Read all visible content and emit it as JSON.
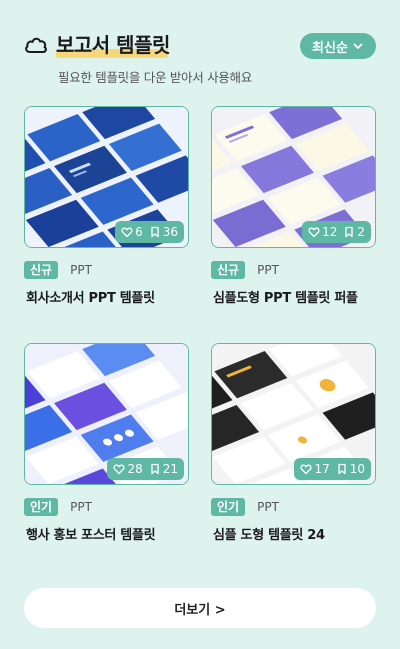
{
  "header": {
    "title": "보고서 템플릿",
    "subtitle": "필요한 템플릿을 다운 받아서 사용해요",
    "sort_label": "최신순",
    "title_icon": "cloud-icon",
    "highlight_color": "#f6d77a"
  },
  "accent_color": "#5fb8a4",
  "cards": [
    {
      "badge": "신규",
      "format": "PPT",
      "name": "회사소개서 PPT 템플릿",
      "likes": "6",
      "bookmarks": "36"
    },
    {
      "badge": "신규",
      "format": "PPT",
      "name": "심플도형 PPT 템플릿 퍼플",
      "likes": "12",
      "bookmarks": "2"
    },
    {
      "badge": "인기",
      "format": "PPT",
      "name": "행사 홍보 포스터 템플릿",
      "likes": "28",
      "bookmarks": "21"
    },
    {
      "badge": "인기",
      "format": "PPT",
      "name": "심플 도형 템플릿 24",
      "likes": "17",
      "bookmarks": "10"
    }
  ],
  "more_label": "더보기 >"
}
